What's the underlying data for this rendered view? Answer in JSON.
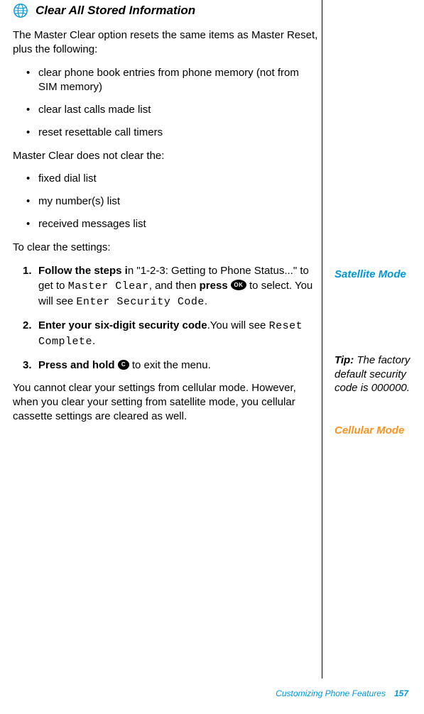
{
  "heading": "Clear All Stored Information",
  "intro": "The Master Clear option resets the same items as Master Reset, plus the following:",
  "bullets1": [
    "clear phone book entries from phone memory (not from SIM memory)",
    "clear last calls made list",
    "reset resettable call timers"
  ],
  "mid_para": "Master Clear does not clear the:",
  "bullets2": [
    "fixed dial list",
    "my number(s) list",
    "received messages list"
  ],
  "to_clear": "To clear the settings:",
  "step1": {
    "num": "1.",
    "bold_a": "Follow the steps i",
    "text_a": "n \"1-2-3: Getting to Phone Status...\" to get to ",
    "lcd_a": "Master Clear",
    "text_b": ", and then ",
    "bold_b": "press",
    "ok": "OK",
    "text_c": " to select. You will see ",
    "lcd_b": "Enter Security Code",
    "text_d": "."
  },
  "step2": {
    "num": "2.",
    "bold_a": "Enter your six-digit security code",
    "text_a": ".You will see ",
    "lcd_a": "Reset Complete",
    "text_b": "."
  },
  "step3": {
    "num": "3.",
    "bold_a": "Press and hold",
    "c": "C",
    "text_a": " to exit the menu."
  },
  "end_para": "You cannot clear your settings from cellular mode. However, when you clear your setting from satellite mode, you cellular cassette settings are cleared as well.",
  "side": {
    "satellite": "Satellite Mode",
    "tip_label": "Tip:",
    "tip_text": " The factory default security code is 000000.",
    "cellular": "Cellular Mode"
  },
  "footer": {
    "text": "Customizing Phone Features",
    "page": "157"
  }
}
